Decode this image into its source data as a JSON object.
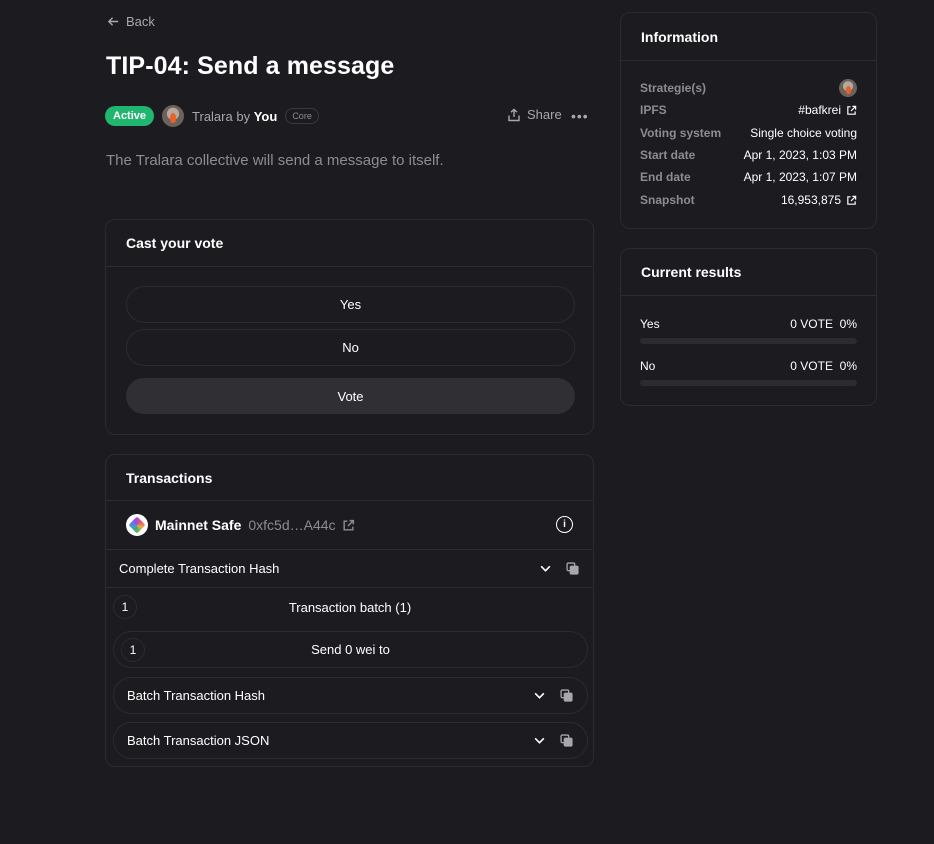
{
  "nav": {
    "back_label": "Back"
  },
  "proposal": {
    "title": "TIP-04: Send a message",
    "status": "Active",
    "space": "Tralara",
    "by_label": "by",
    "author": "You",
    "author_badge": "Core",
    "share_label": "Share",
    "more_label": "•••",
    "body": "The Tralara collective will send a message to itself."
  },
  "vote": {
    "header": "Cast your vote",
    "choices": [
      "Yes",
      "No"
    ],
    "vote_label": "Vote"
  },
  "transactions": {
    "header": "Transactions",
    "safe_name": "Mainnet Safe",
    "safe_address": "0xfc5d…A44c",
    "info_icon": "i",
    "complete_hash_label": "Complete Transaction Hash",
    "batch_number": "1",
    "batch_label": "Transaction batch (1)",
    "tx_number": "1",
    "tx_label": "Send 0 wei to",
    "batch_hash_label": "Batch Transaction Hash",
    "batch_json_label": "Batch Transaction JSON"
  },
  "information": {
    "header": "Information",
    "rows": [
      {
        "key": "Strategie(s)",
        "value": ""
      },
      {
        "key": "IPFS",
        "value": "#bafkrei"
      },
      {
        "key": "Voting system",
        "value": "Single choice voting"
      },
      {
        "key": "Start date",
        "value": "Apr 1, 2023, 1:03 PM"
      },
      {
        "key": "End date",
        "value": "Apr 1, 2023, 1:07 PM"
      },
      {
        "key": "Snapshot",
        "value": "16,953,875"
      }
    ]
  },
  "results": {
    "header": "Current results",
    "items": [
      {
        "choice": "Yes",
        "votes": "0 VOTE",
        "percent": "0%",
        "fraction": 0
      },
      {
        "choice": "No",
        "votes": "0 VOTE",
        "percent": "0%",
        "fraction": 0
      }
    ]
  },
  "colors": {
    "active_badge": "#21b66f",
    "background": "#1c1b1f",
    "border": "#2c2b30",
    "vote_button": "#302f34"
  },
  "icons": [
    "arrow-left-icon",
    "share-icon",
    "more-icon",
    "external-link-icon",
    "info-icon",
    "chevron-down-icon",
    "copy-icon",
    "avatar-icon",
    "safe-logo-icon"
  ]
}
